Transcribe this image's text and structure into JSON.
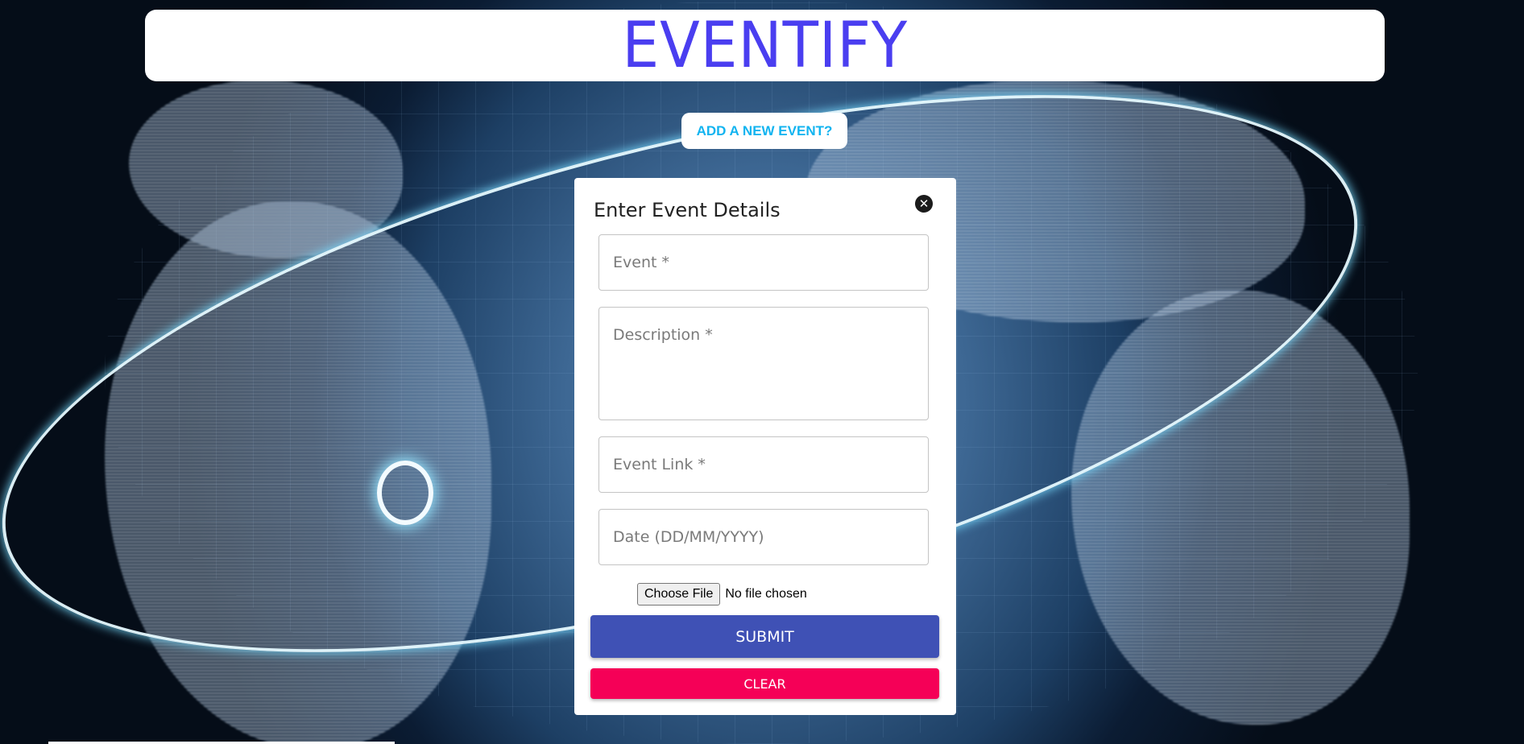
{
  "app": {
    "brand": "EVENTIFY"
  },
  "header": {
    "add_event_label": "ADD A NEW EVENT?"
  },
  "modal": {
    "title": "Enter Event Details",
    "close_icon": "close-icon",
    "fields": {
      "event_placeholder": "Event *",
      "description_placeholder": "Description *",
      "link_placeholder": "Event Link *",
      "date_placeholder": "Date (DD/MM/YYYY)"
    },
    "file": {
      "button_label": "Choose File",
      "status": "No file chosen"
    },
    "submit_label": "SUBMIT",
    "clear_label": "CLEAR"
  },
  "colors": {
    "brand": "#4a3ef0",
    "add_event_text": "#12b4f0",
    "submit": "#3f51b5",
    "clear": "#f50057"
  }
}
